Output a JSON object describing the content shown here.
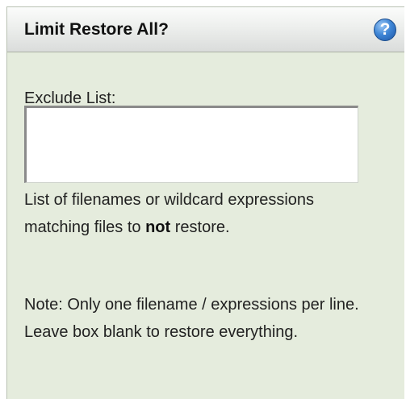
{
  "dialog": {
    "title": "Limit Restore All?",
    "help_glyph": "?",
    "help_icon": "question-mark-circle",
    "colors": {
      "panel_background": "#e5ecdd",
      "header_background": "#eceeec",
      "help_icon": "#3f86d6"
    }
  },
  "exclude_list": {
    "label": "Exclude List:",
    "value": "",
    "placeholder": ""
  },
  "help_text": {
    "before": "List of filenames or wildcard expressions matching files to ",
    "emphasis": "not",
    "after": " restore."
  },
  "note": "Note: Only one filename / expressions per line. Leave box blank to restore everything."
}
